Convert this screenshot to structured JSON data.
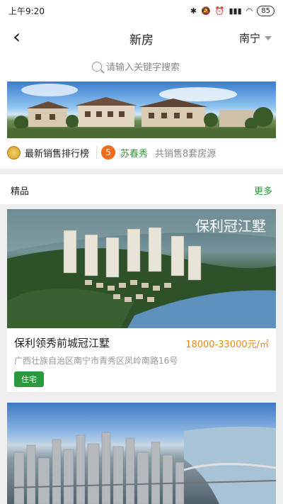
{
  "status_bar": {
    "time": "上午9:20",
    "battery": "85"
  },
  "header": {
    "title": "新房",
    "city": "南宁"
  },
  "search": {
    "placeholder": "请输入关键字搜索"
  },
  "ranking": {
    "title": "最新销售排行榜",
    "rank": "5",
    "agent": "苏春秀",
    "summary": "共销售8套房源"
  },
  "section": {
    "title": "精品",
    "more": "更多"
  },
  "listings": [
    {
      "logo_text": "保利冠江墅",
      "name": "保利领秀前城冠江墅",
      "price": "18000-33000元/㎡",
      "address": "广西壮族自治区南宁市青秀区凤岭南路16号",
      "tag": "住宅"
    }
  ]
}
